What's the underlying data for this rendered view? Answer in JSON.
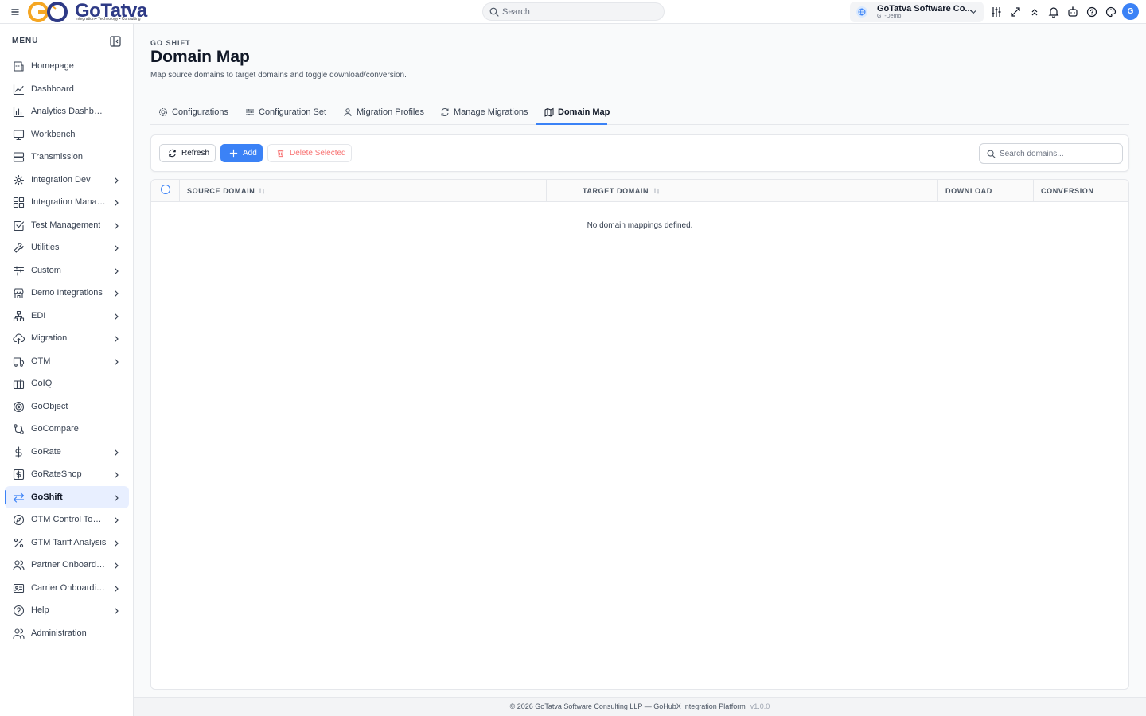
{
  "app": {
    "logo_text": "GoTatva",
    "logo_tagline": "Integration • Technology • Consulting",
    "search_placeholder": "Search",
    "org_name": "GoTatva Software Co...",
    "org_sub": "GT-Demo",
    "avatar_initial": "G"
  },
  "sidebar": {
    "menu_label": "MENU",
    "items": [
      {
        "label": "Homepage",
        "icon": "building-icon",
        "chevron": false
      },
      {
        "label": "Dashboard",
        "icon": "line-chart-icon",
        "chevron": false
      },
      {
        "label": "Analytics Dashboard",
        "icon": "bar-chart-icon",
        "chevron": false
      },
      {
        "label": "Workbench",
        "icon": "monitor-icon",
        "chevron": false
      },
      {
        "label": "Transmission",
        "icon": "server-icon",
        "chevron": false
      },
      {
        "label": "Integration Dev",
        "icon": "gear-icon",
        "chevron": true
      },
      {
        "label": "Integration Manag...",
        "icon": "grid-icon",
        "chevron": true
      },
      {
        "label": "Test Management",
        "icon": "checkbox-icon",
        "chevron": true
      },
      {
        "label": "Utilities",
        "icon": "wrench-icon",
        "chevron": true
      },
      {
        "label": "Custom",
        "icon": "sliders-icon",
        "chevron": true
      },
      {
        "label": "Demo Integrations",
        "icon": "store-icon",
        "chevron": true
      },
      {
        "label": "EDI",
        "icon": "network-icon",
        "chevron": true
      },
      {
        "label": "Migration",
        "icon": "cloud-upload-icon",
        "chevron": true
      },
      {
        "label": "OTM",
        "icon": "truck-icon",
        "chevron": true
      },
      {
        "label": "GoIQ",
        "icon": "columns-icon",
        "chevron": false
      },
      {
        "label": "GoObject",
        "icon": "target-icon",
        "chevron": false
      },
      {
        "label": "GoCompare",
        "icon": "git-compare-icon",
        "chevron": false
      },
      {
        "label": "GoRate",
        "icon": "dollar-icon",
        "chevron": true
      },
      {
        "label": "GoRateShop",
        "icon": "dollar-square-icon",
        "chevron": true
      },
      {
        "label": "GoShift",
        "icon": "arrows-swap-icon",
        "chevron": true,
        "active": true
      },
      {
        "label": "OTM Control Tower",
        "icon": "compass-icon",
        "chevron": true
      },
      {
        "label": "GTM Tariff Analysis",
        "icon": "percent-icon",
        "chevron": true
      },
      {
        "label": "Partner Onboarding",
        "icon": "users-icon",
        "chevron": true
      },
      {
        "label": "Carrier Onboardin...",
        "icon": "id-card-icon",
        "chevron": true
      },
      {
        "label": "Help",
        "icon": "help-circle-icon",
        "chevron": true
      },
      {
        "label": "Administration",
        "icon": "users-icon",
        "chevron": false
      }
    ]
  },
  "header": {
    "eyebrow": "GO SHIFT",
    "title": "Domain Map",
    "subtitle": "Map source domains to target domains and toggle download/conversion."
  },
  "tabs": [
    {
      "label": "Configurations",
      "icon": "gear-icon"
    },
    {
      "label": "Configuration Set",
      "icon": "sliders-icon"
    },
    {
      "label": "Migration Profiles",
      "icon": "user-icon"
    },
    {
      "label": "Manage Migrations",
      "icon": "refresh-icon"
    },
    {
      "label": "Domain Map",
      "icon": "map-icon",
      "active": true
    }
  ],
  "toolbar": {
    "refresh_label": "Refresh",
    "add_label": "Add",
    "delete_label": "Delete Selected",
    "search_placeholder": "Search domains..."
  },
  "table": {
    "columns": [
      "SOURCE DOMAIN",
      "TARGET DOMAIN",
      "DOWNLOAD",
      "CONVERSION"
    ],
    "empty_text": "No domain mappings defined."
  },
  "footer": {
    "text": "© 2026 GoTatva Software Consulting LLP — GoHubX Integration Platform",
    "version": "v1.0.0"
  },
  "colors": {
    "accent": "#3b82f6",
    "active_bg": "#e8efff",
    "danger": "#f87171",
    "logo_blue": "#2e3a86",
    "logo_orange": "#f5a623"
  }
}
